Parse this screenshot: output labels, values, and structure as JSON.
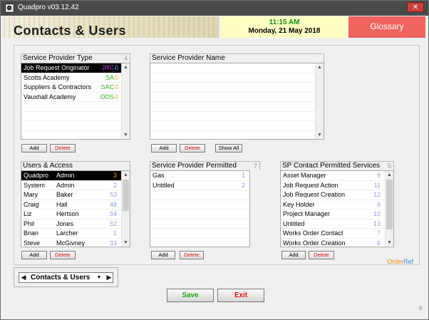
{
  "window": {
    "title": "Quadpro v03.12.42",
    "close_label": "✕"
  },
  "banner": {
    "heading": "Contacts & Users",
    "time": "11:15 AM",
    "date": "Monday, 21 May 2018",
    "glossary_label": "Glossary"
  },
  "provider_type": {
    "title": "Service Provider Type",
    "count": "4",
    "items": [
      {
        "name": "Job Request Originator",
        "code": "JRC",
        "order": "0",
        "code_color": "#c040e0"
      },
      {
        "name": "Scotts Academy",
        "code": "SA",
        "order": "0",
        "code_color": "#30b030"
      },
      {
        "name": "Suppliers & Contractors",
        "code": "SAC",
        "order": "0",
        "code_color": "#30b030"
      },
      {
        "name": "Vauxhall Academy",
        "code": "ODS",
        "order": "0",
        "code_color": "#30b030"
      }
    ],
    "add_label": "Add",
    "delete_label": "Delete"
  },
  "provider_name": {
    "title": "Service Provider Name",
    "add_label": "Add",
    "delete_label": "Delete",
    "show_all_label": "Show All"
  },
  "users": {
    "title": "Users & Access",
    "items": [
      {
        "first": "Quadpro",
        "last": "Admin",
        "num": "3"
      },
      {
        "first": "System",
        "last": "Admin",
        "num": "2"
      },
      {
        "first": "Mary",
        "last": "Baker",
        "num": "53"
      },
      {
        "first": "Craig",
        "last": "Hall",
        "num": "48"
      },
      {
        "first": "Liz",
        "last": "Hertson",
        "num": "54"
      },
      {
        "first": "Phil",
        "last": "Jones",
        "num": "52"
      },
      {
        "first": "Brian",
        "last": "Larcher",
        "num": "1"
      },
      {
        "first": "Steve",
        "last": "McGivney",
        "num": "33"
      }
    ],
    "add_label": "Add",
    "delete_label": "Delete"
  },
  "permitted_services": {
    "title": "Service Provider Permitted Services",
    "count": "7",
    "items": [
      {
        "name": "Gas",
        "num": "1"
      },
      {
        "name": "Untitled",
        "num": "2"
      }
    ],
    "add_label": "Add",
    "delete_label": "Delete"
  },
  "sp_contact_services": {
    "title": "SP Contact Permitted Services",
    "count": "5",
    "items": [
      {
        "name": "Asset Manager",
        "num": "9"
      },
      {
        "name": "Job Request Action",
        "num": "11"
      },
      {
        "name": "Job Request Creation",
        "num": "12"
      },
      {
        "name": "Key Holder",
        "num": "8"
      },
      {
        "name": "Project Manager",
        "num": "10"
      },
      {
        "name": "Untitled",
        "num": "13"
      },
      {
        "name": "Works Order Contact",
        "num": "7"
      },
      {
        "name": "Works Order Creation",
        "num": "6"
      }
    ],
    "add_label": "Add",
    "delete_label": "Delete"
  },
  "legend": {
    "order": "Order",
    "ref": "Ref"
  },
  "nav": {
    "label": "Contacts & Users",
    "prev": "◀",
    "next": "▶",
    "dropdown": "▼"
  },
  "actions": {
    "save_label": "Save",
    "exit_label": "Exit",
    "save_color": "#20a020",
    "exit_color": "#e01010"
  },
  "corner_number": "6"
}
